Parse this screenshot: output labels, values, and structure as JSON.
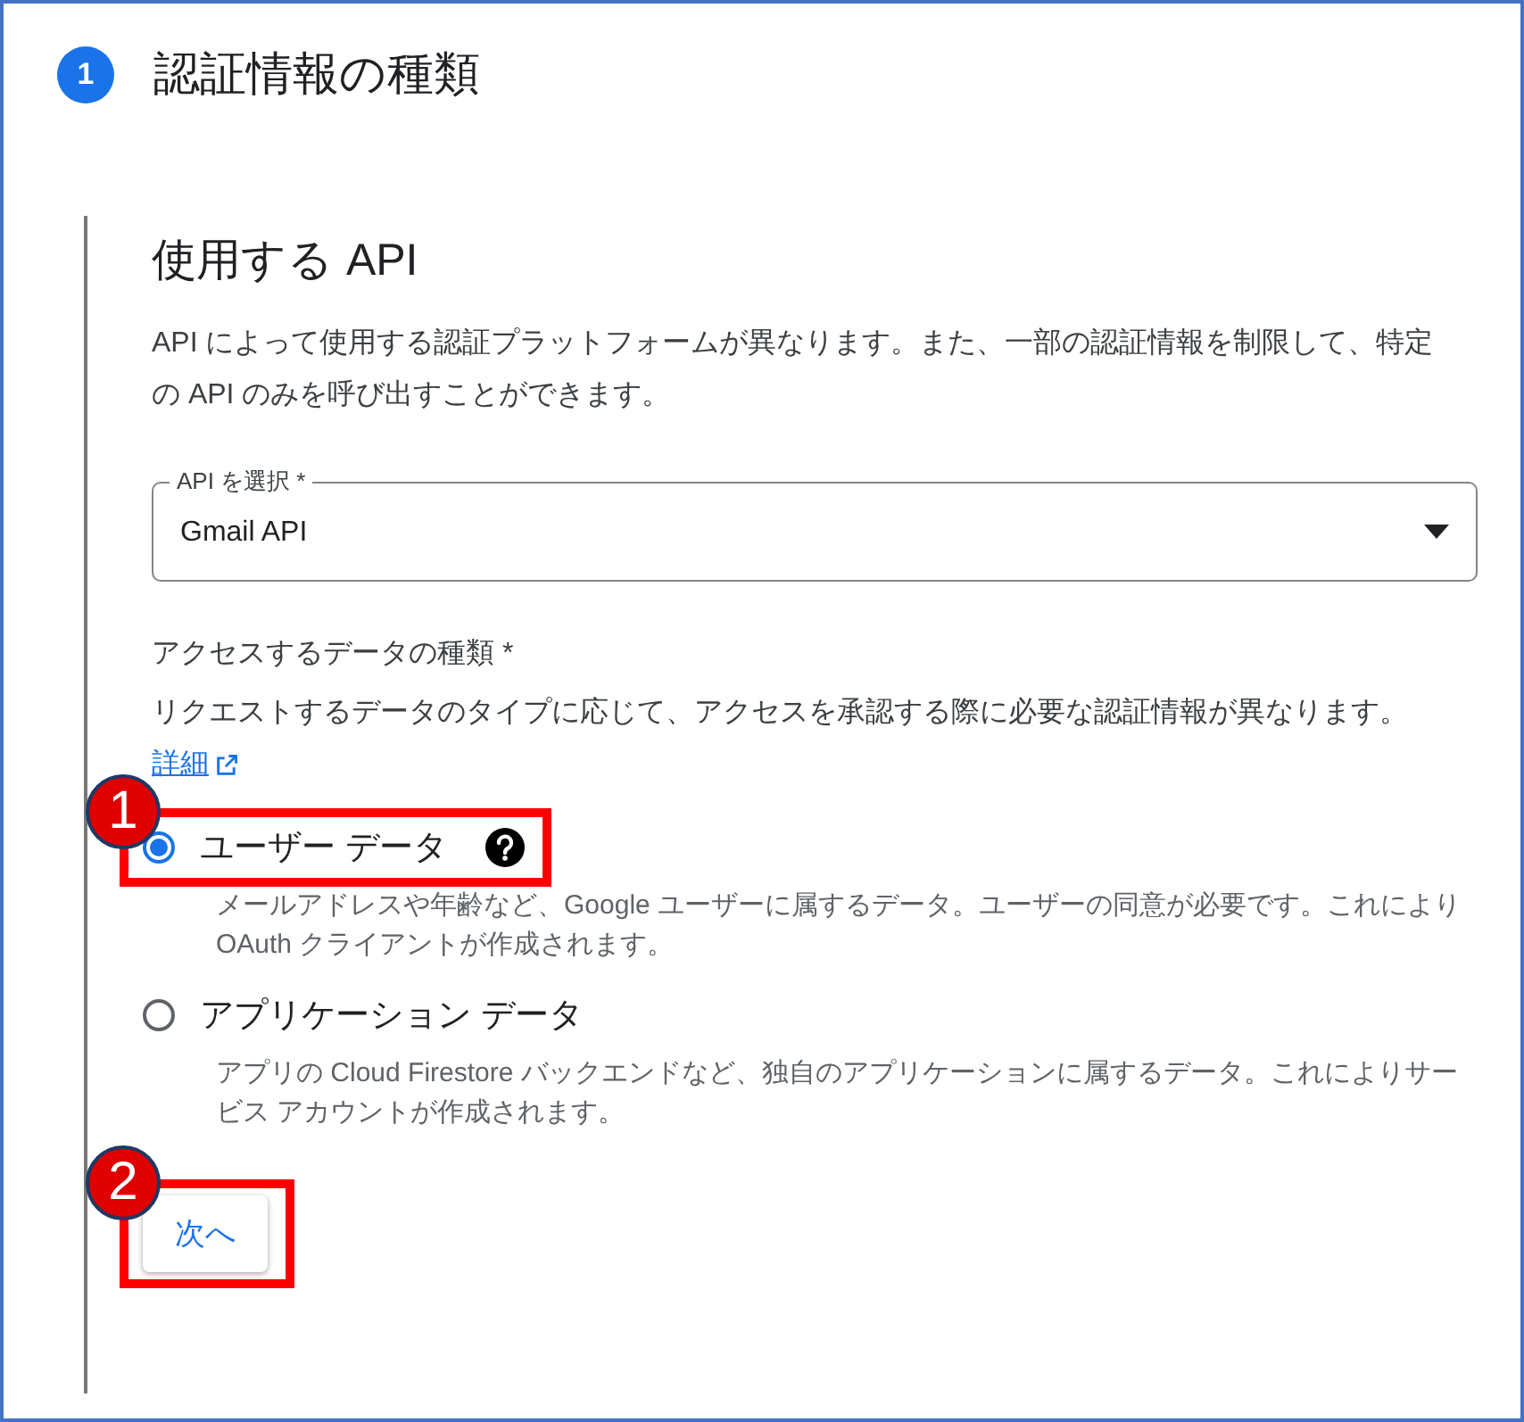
{
  "step": {
    "number": "1",
    "title": "認証情報の種類"
  },
  "section": {
    "title": "使用する API",
    "description": "API によって使用する認証プラットフォームが異なります。また、一部の認証情報を制限して、特定の API のみを呼び出すことができます。"
  },
  "api_select": {
    "label": "API を選択 *",
    "value": "Gmail API"
  },
  "access": {
    "title": "アクセスするデータの種類 *",
    "description": "リクエストするデータのタイプに応じて、アクセスを承認する際に必要な認証情報が異なります。",
    "link": "詳細"
  },
  "options": [
    {
      "label": "ユーザー データ",
      "selected": true,
      "help": true,
      "annotation": "1",
      "description": "メールアドレスや年齢など、Google ユーザーに属するデータ。ユーザーの同意が必要です。これにより OAuth クライアントが作成されます。"
    },
    {
      "label": "アプリケーション データ",
      "selected": false,
      "help": false,
      "description": "アプリの Cloud Firestore バックエンドなど、独自のアプリケーションに属するデータ。これによりサービス アカウントが作成されます。"
    }
  ],
  "next_button": {
    "label": "次へ",
    "annotation": "2"
  }
}
